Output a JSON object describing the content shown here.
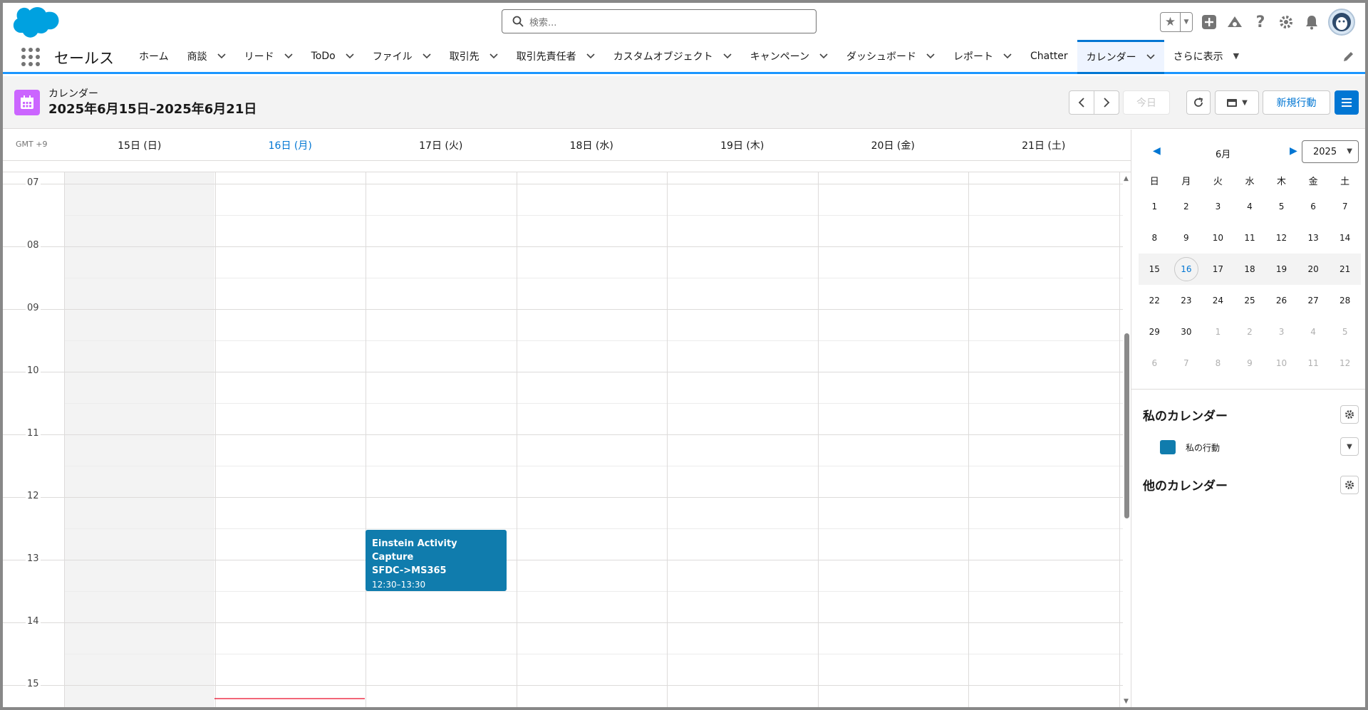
{
  "search": {
    "placeholder": "検索..."
  },
  "app": {
    "name": "セールス"
  },
  "nav": {
    "items": [
      {
        "label": "ホーム",
        "chevron": false
      },
      {
        "label": "商談",
        "chevron": true
      },
      {
        "label": "リード",
        "chevron": true
      },
      {
        "label": "ToDo",
        "chevron": true
      },
      {
        "label": "ファイル",
        "chevron": true
      },
      {
        "label": "取引先",
        "chevron": true
      },
      {
        "label": "取引先責任者",
        "chevron": true
      },
      {
        "label": "カスタムオブジェクト",
        "chevron": true
      },
      {
        "label": "キャンペーン",
        "chevron": true
      },
      {
        "label": "ダッシュボード",
        "chevron": true
      },
      {
        "label": "レポート",
        "chevron": true
      },
      {
        "label": "Chatter",
        "chevron": false
      },
      {
        "label": "カレンダー",
        "chevron": true,
        "active": true
      },
      {
        "label": "さらに表示",
        "chevron": true,
        "caret": true
      }
    ]
  },
  "calendar": {
    "subtitle": "カレンダー",
    "title": "2025年6月15日–2025年6月21日",
    "today_label": "今日",
    "new_event_label": "新規行動",
    "timezone": "GMT +9",
    "days": [
      "15日 (日)",
      "16日 (月)",
      "17日 (火)",
      "18日 (水)",
      "19日 (木)",
      "20日 (金)",
      "21日 (土)"
    ],
    "hours": [
      "07",
      "08",
      "09",
      "10",
      "11",
      "12",
      "13",
      "14",
      "15"
    ],
    "event": {
      "title_line1": "Einstein Activity Capture",
      "title_line2": "SFDC->MS365",
      "time": "12:30–13:30",
      "color": "#107cad"
    }
  },
  "mini_calendar": {
    "month": "6月",
    "year": "2025",
    "weekdays": [
      "日",
      "月",
      "火",
      "水",
      "木",
      "金",
      "土"
    ],
    "weeks": [
      [
        "1",
        "2",
        "3",
        "4",
        "5",
        "6",
        "7"
      ],
      [
        "8",
        "9",
        "10",
        "11",
        "12",
        "13",
        "14"
      ],
      [
        "15",
        "16",
        "17",
        "18",
        "19",
        "20",
        "21"
      ],
      [
        "22",
        "23",
        "24",
        "25",
        "26",
        "27",
        "28"
      ],
      [
        "29",
        "30",
        "1",
        "2",
        "3",
        "4",
        "5"
      ],
      [
        "6",
        "7",
        "8",
        "9",
        "10",
        "11",
        "12"
      ]
    ],
    "today": "16"
  },
  "my_calendars": {
    "title": "私のカレンダー",
    "items": [
      {
        "label": "私の行動",
        "color": "#107cad"
      }
    ]
  },
  "other_calendars": {
    "title": "他のカレンダー"
  },
  "colors": {
    "accent": "#0176d3",
    "calendar_icon": "#cb65ff",
    "now_line": "#ea001e"
  }
}
